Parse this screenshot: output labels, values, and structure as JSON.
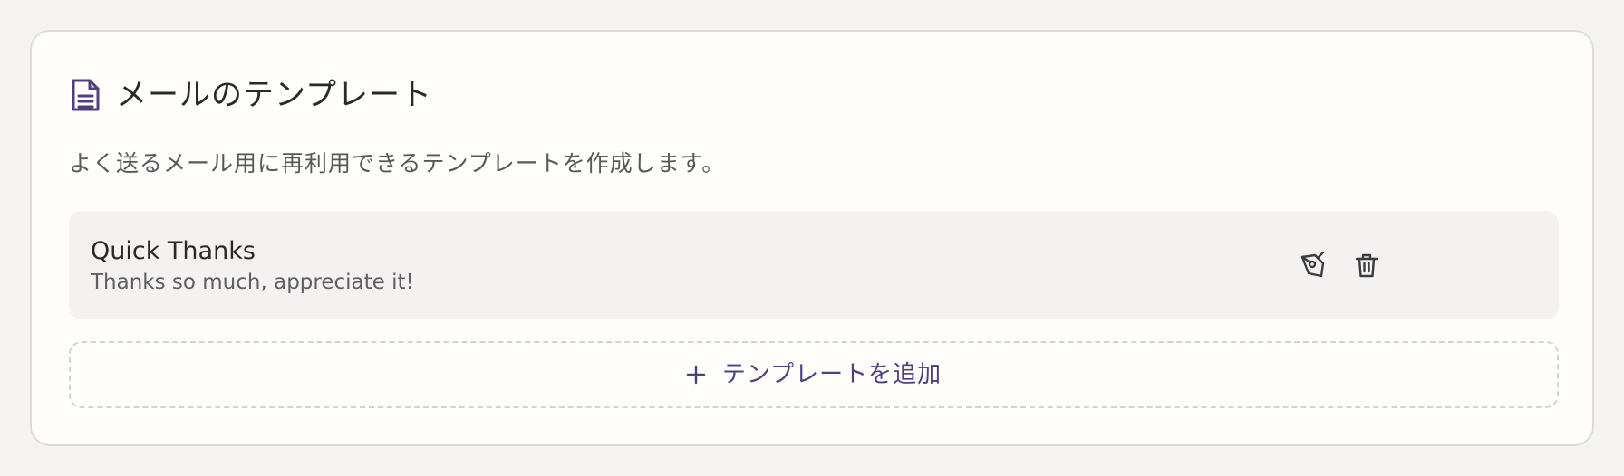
{
  "section": {
    "title": "メールのテンプレート",
    "description": "よく送るメール用に再利用できるテンプレートを作成します。",
    "title_icon": "document-icon"
  },
  "templates": [
    {
      "name": "Quick Thanks",
      "body": "Thanks so much, appreciate it!",
      "actions": [
        "pen-icon",
        "trash-icon"
      ]
    }
  ],
  "add_button": {
    "label": "テンプレートを追加",
    "icon": "plus-icon"
  },
  "colors": {
    "accent": "#4d3f80",
    "card_background": "#fefdfa",
    "page_background": "#f4f3f1",
    "item_background": "#f3f2f0"
  }
}
